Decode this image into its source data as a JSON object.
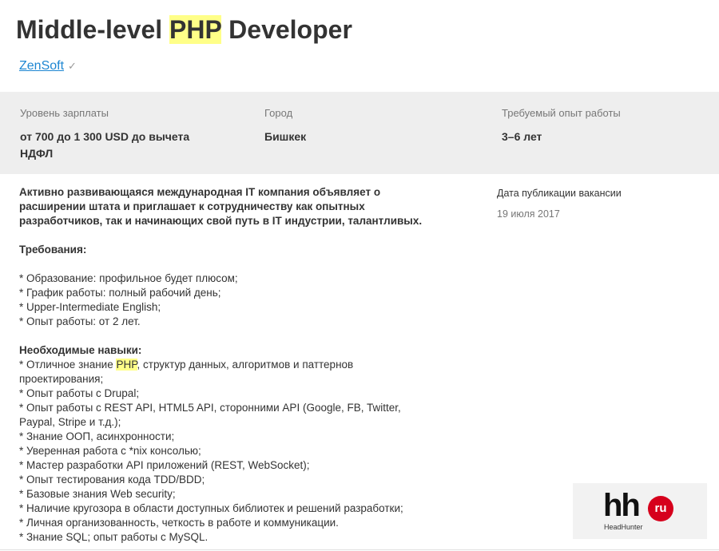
{
  "header": {
    "title_prefix": "Middle-level ",
    "title_highlight": "PHP",
    "title_suffix": " Developer",
    "company": "ZenSoft",
    "verified_icon": "checkmark-icon"
  },
  "info": {
    "salary_label": "Уровень зарплаты",
    "salary_value_line1": "от 700 до 1 300 USD до вычета",
    "salary_value_line2": "НДФЛ",
    "city_label": "Город",
    "city_value": "Бишкек",
    "experience_label": "Требуемый опыт работы",
    "experience_value": "3–6 лет"
  },
  "description": {
    "intro_lines": [
      "Активно развивающаяся международная IT компания объявляет о",
      "расширении штата и приглашает к сотрудничеству как опытных",
      "разработчиков, так и начинающих свой путь в IT индустрии, талантливых."
    ],
    "requirements_heading": "Требования:",
    "requirements": [
      "* Образование: профильное будет плюсом;",
      "* График работы: полный рабочий день;",
      "* Upper-Intermediate English;",
      "* Опыт работы: от 2 лет."
    ],
    "skills_heading": "Необходимые навыки:",
    "skill_php_prefix": "* Отличное знание ",
    "skill_php_highlight": "PHP",
    "skill_php_suffix": ", структур данных, алгоритмов и паттернов",
    "skill_php_line2": "проектирования;",
    "skills": [
      "* Опыт работы с Drupal;",
      "* Опыт работы с REST API, HTML5 API, сторонними API (Google, FB, Twitter,",
      "Paypal, Stripe и т.д.);",
      "* Знание ООП, асинхронности;",
      "* Уверенная работа с *nix консолью;",
      "* Мастер разработки API приложений (REST, WebSocket);",
      "* Опыт тестирования кода TDD/BDD;",
      "* Базовые знания Web security;",
      "* Наличие кругозора в области доступных библиотек и решений разработки;",
      "* Личная организованность, четкость в работе и коммуникации.",
      "* Знание SQL; опыт работы с MySQL."
    ]
  },
  "aside": {
    "pub_label": "Дата публикации вакансии",
    "pub_date": "19 июля 2017"
  },
  "logo": {
    "text": "hh",
    "circle_text": "ru",
    "subtitle": "HeadHunter",
    "brand_color": "#d6001c"
  },
  "colors": {
    "link": "#1d86d2",
    "highlight": "#ffff88",
    "info_bg": "#eeeeee"
  }
}
